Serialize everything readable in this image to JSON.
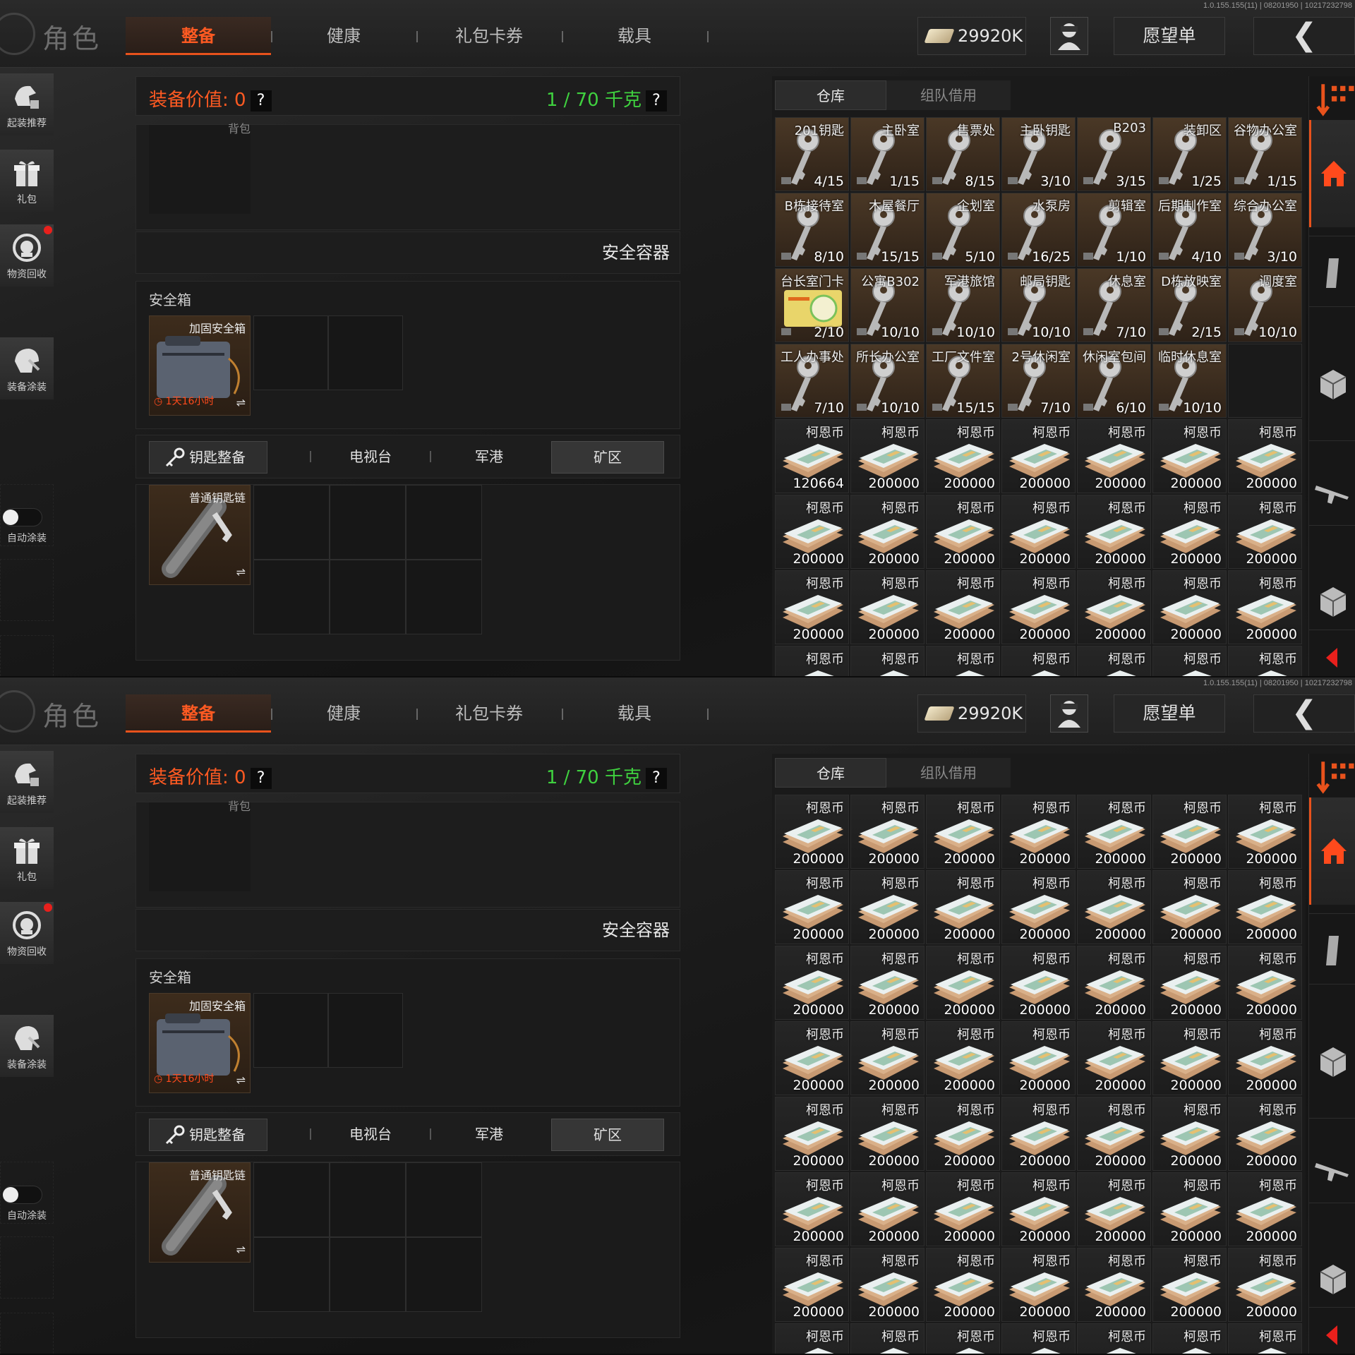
{
  "screens": [
    {
      "version": "1.0.155.155(11) | 08201950 | 10217232798",
      "topbar": {
        "title": "角色",
        "tabs": [
          "整备",
          "健康",
          "礼包卡券",
          "载具"
        ],
        "currency": "29920K",
        "wishlist": "愿望单"
      },
      "sidebar": {
        "items": [
          "起装推荐",
          "礼包",
          "物资回收",
          "装备涂装"
        ],
        "toggle_label": "自动涂装"
      },
      "left": {
        "equip_value": "装备价值: 0",
        "weight": "1 / 70 千克",
        "backpack": "背包",
        "safe_header": "安全容器",
        "safe_label": "安全箱",
        "safe_item": "加固安全箱",
        "safe_timer": "1天16小时",
        "key_button": "钥匙整备",
        "key_tabs": [
          "电视台",
          "军港",
          "矿区"
        ],
        "key_item": "普通钥匙链"
      },
      "right": {
        "tabs": [
          "仓库",
          "组队借用"
        ],
        "cells": [
          {
            "name": "201钥匙",
            "count": "4/15",
            "type": "key"
          },
          {
            "name": "主卧室",
            "count": "1/15",
            "type": "key"
          },
          {
            "name": "售票处",
            "count": "8/15",
            "type": "key"
          },
          {
            "name": "主卧钥匙",
            "count": "3/10",
            "type": "key"
          },
          {
            "name": "B203",
            "count": "3/15",
            "type": "key"
          },
          {
            "name": "装卸区",
            "count": "1/25",
            "type": "key"
          },
          {
            "name": "谷物办公室",
            "count": "1/15",
            "type": "key"
          },
          {
            "name": "B栋接待室",
            "count": "8/10",
            "type": "key"
          },
          {
            "name": "木屋餐厅",
            "count": "15/15",
            "type": "key"
          },
          {
            "name": "企划室",
            "count": "5/10",
            "type": "key"
          },
          {
            "name": "水泵房",
            "count": "16/25",
            "type": "key"
          },
          {
            "name": "剪辑室",
            "count": "1/10",
            "type": "key"
          },
          {
            "name": "后期制作室",
            "count": "4/10",
            "type": "key"
          },
          {
            "name": "综合办公室",
            "count": "3/10",
            "type": "key"
          },
          {
            "name": "台长室门卡",
            "count": "2/10",
            "type": "card"
          },
          {
            "name": "公寓B302",
            "count": "10/10",
            "type": "key"
          },
          {
            "name": "军港旅馆",
            "count": "10/10",
            "type": "key"
          },
          {
            "name": "邮局钥匙",
            "count": "10/10",
            "type": "key"
          },
          {
            "name": "休息室",
            "count": "7/10",
            "type": "key"
          },
          {
            "name": "D栋放映室",
            "count": "2/15",
            "type": "key"
          },
          {
            "name": "调度室",
            "count": "10/10",
            "type": "key"
          },
          {
            "name": "工人办事处",
            "count": "7/10",
            "type": "key"
          },
          {
            "name": "所长办公室",
            "count": "10/10",
            "type": "key"
          },
          {
            "name": "工厂文件室",
            "count": "15/15",
            "type": "key"
          },
          {
            "name": "2号休闲室",
            "count": "7/10",
            "type": "key"
          },
          {
            "name": "休闲室包间",
            "count": "6/10",
            "type": "key"
          },
          {
            "name": "临时休息室",
            "count": "10/10",
            "type": "key"
          },
          {
            "name": "",
            "count": "",
            "type": "empty"
          },
          {
            "name": "柯恩币",
            "count": "120664",
            "type": "coin"
          },
          {
            "name": "柯恩币",
            "count": "200000",
            "type": "coin"
          },
          {
            "name": "柯恩币",
            "count": "200000",
            "type": "coin"
          },
          {
            "name": "柯恩币",
            "count": "200000",
            "type": "coin"
          },
          {
            "name": "柯恩币",
            "count": "200000",
            "type": "coin"
          },
          {
            "name": "柯恩币",
            "count": "200000",
            "type": "coin"
          },
          {
            "name": "柯恩币",
            "count": "200000",
            "type": "coin"
          },
          {
            "name": "柯恩币",
            "count": "200000",
            "type": "coin"
          },
          {
            "name": "柯恩币",
            "count": "200000",
            "type": "coin"
          },
          {
            "name": "柯恩币",
            "count": "200000",
            "type": "coin"
          },
          {
            "name": "柯恩币",
            "count": "200000",
            "type": "coin"
          },
          {
            "name": "柯恩币",
            "count": "200000",
            "type": "coin"
          },
          {
            "name": "柯恩币",
            "count": "200000",
            "type": "coin"
          },
          {
            "name": "柯恩币",
            "count": "200000",
            "type": "coin"
          },
          {
            "name": "柯恩币",
            "count": "200000",
            "type": "coin"
          },
          {
            "name": "柯恩币",
            "count": "200000",
            "type": "coin"
          },
          {
            "name": "柯恩币",
            "count": "200000",
            "type": "coin"
          },
          {
            "name": "柯恩币",
            "count": "200000",
            "type": "coin"
          },
          {
            "name": "柯恩币",
            "count": "200000",
            "type": "coin"
          },
          {
            "name": "柯恩币",
            "count": "200000",
            "type": "coin"
          },
          {
            "name": "柯恩币",
            "count": "200000",
            "type": "coin"
          },
          {
            "name": "柯恩币",
            "count": "",
            "type": "coin"
          },
          {
            "name": "柯恩币",
            "count": "",
            "type": "coin"
          },
          {
            "name": "柯恩币",
            "count": "",
            "type": "coin"
          },
          {
            "name": "柯恩币",
            "count": "",
            "type": "coin"
          },
          {
            "name": "柯恩币",
            "count": "",
            "type": "coin"
          },
          {
            "name": "柯恩币",
            "count": "",
            "type": "coin"
          },
          {
            "name": "柯恩币",
            "count": "",
            "type": "coin"
          }
        ]
      }
    },
    {
      "version": "1.0.155.155(11) | 08201950 | 10217232798",
      "topbar": {
        "title": "角色",
        "tabs": [
          "整备",
          "健康",
          "礼包卡券",
          "载具"
        ],
        "currency": "29920K",
        "wishlist": "愿望单"
      },
      "sidebar": {
        "items": [
          "起装推荐",
          "礼包",
          "物资回收",
          "装备涂装"
        ],
        "toggle_label": "自动涂装"
      },
      "left": {
        "equip_value": "装备价值: 0",
        "weight": "1 / 70 千克",
        "backpack": "背包",
        "safe_header": "安全容器",
        "safe_label": "安全箱",
        "safe_item": "加固安全箱",
        "safe_timer": "1天16小时",
        "key_button": "钥匙整备",
        "key_tabs": [
          "电视台",
          "军港",
          "矿区"
        ],
        "key_item": "普通钥匙链"
      },
      "right": {
        "tabs": [
          "仓库",
          "组队借用"
        ],
        "cells": [
          {
            "name": "柯恩币",
            "count": "200000",
            "type": "coin"
          },
          {
            "name": "柯恩币",
            "count": "200000",
            "type": "coin"
          },
          {
            "name": "柯恩币",
            "count": "200000",
            "type": "coin"
          },
          {
            "name": "柯恩币",
            "count": "200000",
            "type": "coin"
          },
          {
            "name": "柯恩币",
            "count": "200000",
            "type": "coin"
          },
          {
            "name": "柯恩币",
            "count": "200000",
            "type": "coin"
          },
          {
            "name": "柯恩币",
            "count": "200000",
            "type": "coin"
          },
          {
            "name": "柯恩币",
            "count": "200000",
            "type": "coin"
          },
          {
            "name": "柯恩币",
            "count": "200000",
            "type": "coin"
          },
          {
            "name": "柯恩币",
            "count": "200000",
            "type": "coin"
          },
          {
            "name": "柯恩币",
            "count": "200000",
            "type": "coin"
          },
          {
            "name": "柯恩币",
            "count": "200000",
            "type": "coin"
          },
          {
            "name": "柯恩币",
            "count": "200000",
            "type": "coin"
          },
          {
            "name": "柯恩币",
            "count": "200000",
            "type": "coin"
          },
          {
            "name": "柯恩币",
            "count": "200000",
            "type": "coin"
          },
          {
            "name": "柯恩币",
            "count": "200000",
            "type": "coin"
          },
          {
            "name": "柯恩币",
            "count": "200000",
            "type": "coin"
          },
          {
            "name": "柯恩币",
            "count": "200000",
            "type": "coin"
          },
          {
            "name": "柯恩币",
            "count": "200000",
            "type": "coin"
          },
          {
            "name": "柯恩币",
            "count": "200000",
            "type": "coin"
          },
          {
            "name": "柯恩币",
            "count": "200000",
            "type": "coin"
          },
          {
            "name": "柯恩币",
            "count": "200000",
            "type": "coin"
          },
          {
            "name": "柯恩币",
            "count": "200000",
            "type": "coin"
          },
          {
            "name": "柯恩币",
            "count": "200000",
            "type": "coin"
          },
          {
            "name": "柯恩币",
            "count": "200000",
            "type": "coin"
          },
          {
            "name": "柯恩币",
            "count": "200000",
            "type": "coin"
          },
          {
            "name": "柯恩币",
            "count": "200000",
            "type": "coin"
          },
          {
            "name": "柯恩币",
            "count": "200000",
            "type": "coin"
          },
          {
            "name": "柯恩币",
            "count": "200000",
            "type": "coin"
          },
          {
            "name": "柯恩币",
            "count": "200000",
            "type": "coin"
          },
          {
            "name": "柯恩币",
            "count": "200000",
            "type": "coin"
          },
          {
            "name": "柯恩币",
            "count": "200000",
            "type": "coin"
          },
          {
            "name": "柯恩币",
            "count": "200000",
            "type": "coin"
          },
          {
            "name": "柯恩币",
            "count": "200000",
            "type": "coin"
          },
          {
            "name": "柯恩币",
            "count": "200000",
            "type": "coin"
          },
          {
            "name": "柯恩币",
            "count": "200000",
            "type": "coin"
          },
          {
            "name": "柯恩币",
            "count": "200000",
            "type": "coin"
          },
          {
            "name": "柯恩币",
            "count": "200000",
            "type": "coin"
          },
          {
            "name": "柯恩币",
            "count": "200000",
            "type": "coin"
          },
          {
            "name": "柯恩币",
            "count": "200000",
            "type": "coin"
          },
          {
            "name": "柯恩币",
            "count": "200000",
            "type": "coin"
          },
          {
            "name": "柯恩币",
            "count": "200000",
            "type": "coin"
          },
          {
            "name": "柯恩币",
            "count": "200000",
            "type": "coin"
          },
          {
            "name": "柯恩币",
            "count": "200000",
            "type": "coin"
          },
          {
            "name": "柯恩币",
            "count": "200000",
            "type": "coin"
          },
          {
            "name": "柯恩币",
            "count": "200000",
            "type": "coin"
          },
          {
            "name": "柯恩币",
            "count": "200000",
            "type": "coin"
          },
          {
            "name": "柯恩币",
            "count": "200000",
            "type": "coin"
          },
          {
            "name": "柯恩币",
            "count": "200000",
            "type": "coin"
          },
          {
            "name": "柯恩币",
            "count": "",
            "type": "coin"
          },
          {
            "name": "柯恩币",
            "count": "",
            "type": "coin"
          },
          {
            "name": "柯恩币",
            "count": "",
            "type": "coin"
          },
          {
            "name": "柯恩币",
            "count": "",
            "type": "coin"
          },
          {
            "name": "柯恩币",
            "count": "",
            "type": "coin"
          },
          {
            "name": "柯恩币",
            "count": "",
            "type": "coin"
          },
          {
            "name": "柯恩币",
            "count": "",
            "type": "coin"
          }
        ]
      }
    }
  ],
  "colors": {
    "accent": "#e8521c",
    "weight_green": "#3fd13f",
    "key_bg": "#3d2c1c",
    "alert": "#e8201c"
  },
  "icons": [
    "globe-icon",
    "money-icon",
    "avatar-icon",
    "back-chevron-icon",
    "recommend-icon",
    "gift-icon",
    "recycle-icon",
    "paint-icon",
    "key-icon",
    "safe-case-icon",
    "keychain-icon",
    "home-icon",
    "ammo-icon",
    "crate-icon",
    "rifle-icon",
    "sort-icon"
  ]
}
